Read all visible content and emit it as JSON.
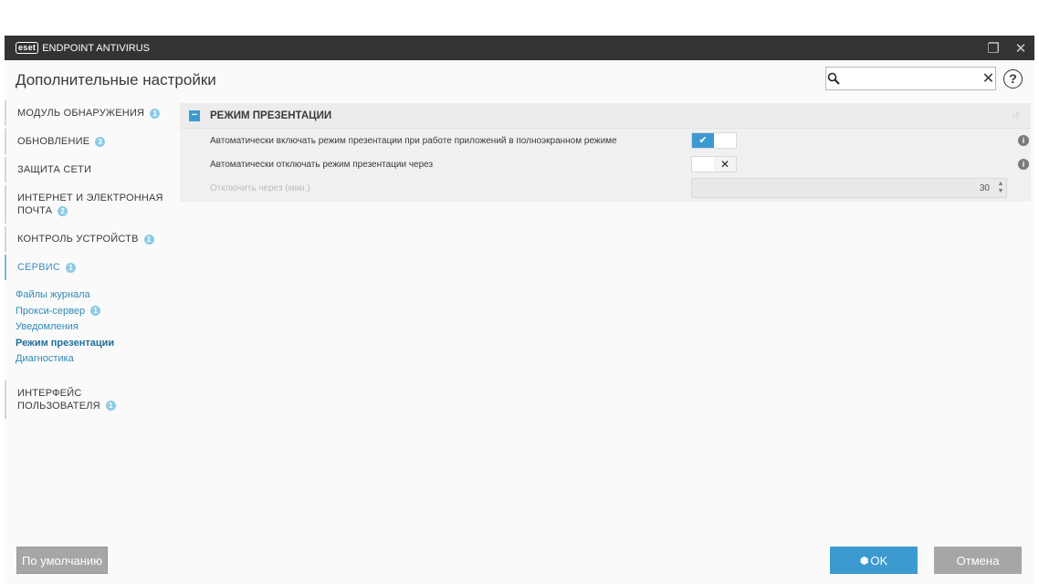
{
  "window": {
    "logo_text": "eset",
    "product_name": "ENDPOINT ANTIVIRUS"
  },
  "header": {
    "page_title": "Дополнительные настройки",
    "search": {
      "value": "",
      "placeholder": ""
    }
  },
  "sidebar": {
    "sections": [
      {
        "label": "МОДУЛЬ ОБНАРУЖЕНИЯ",
        "badge": "1"
      },
      {
        "label": "ОБНОВЛЕНИЕ",
        "badge": "3"
      },
      {
        "label": "ЗАЩИТА СЕТИ",
        "badge": ""
      },
      {
        "label_line1": "ИНТЕРНЕТ И ЭЛЕКТРОННАЯ",
        "label_line2": "ПОЧТА",
        "badge": "2"
      },
      {
        "label": "КОНТРОЛЬ УСТРОЙСТВ",
        "badge": "1"
      },
      {
        "label": "СЕРВИС",
        "badge": "1"
      },
      {
        "label_line1": "ИНТЕРФЕЙС",
        "label_line2": "ПОЛЬЗОВАТЕЛЯ",
        "badge": "1"
      }
    ],
    "service_items": [
      {
        "label": "Файлы журнала",
        "badge": ""
      },
      {
        "label": "Прокси-сервер",
        "badge": "1"
      },
      {
        "label": "Уведомления",
        "badge": ""
      },
      {
        "label": "Режим презентации",
        "badge": ""
      },
      {
        "label": "Диагностика",
        "badge": ""
      }
    ]
  },
  "panel": {
    "title": "РЕЖИМ ПРЕЗЕНТАЦИИ",
    "rows": [
      {
        "label": "Автоматически включать режим презентации при работе приложений в полноэкранном режиме",
        "state": "✔"
      },
      {
        "label": "Автоматически отключать режим презентации через",
        "state": "✕"
      },
      {
        "label": "Отключить через (мин.)",
        "value": "30"
      }
    ]
  },
  "footer": {
    "default_label": "По умолчанию",
    "ok_label": "OK",
    "cancel_label": "Отмена"
  },
  "colors": {
    "accent": "#3d9ad1",
    "titlebar": "#333333",
    "badge": "#8ccbe6",
    "button_gray": "#a6a6a6"
  }
}
